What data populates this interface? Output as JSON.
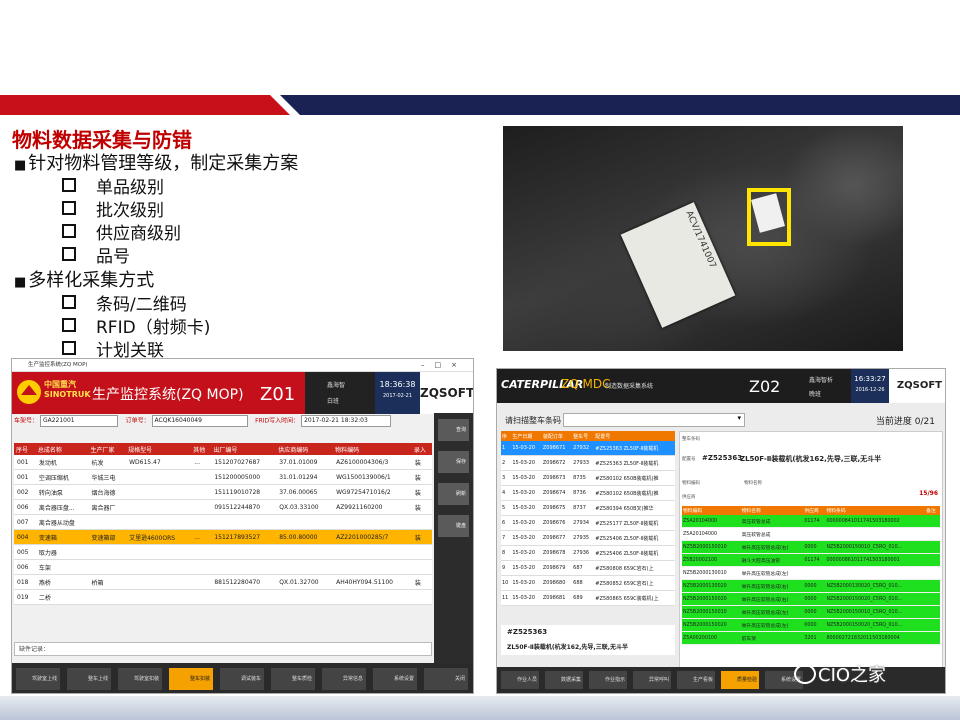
{
  "slide": {
    "title": "物料数据采集与防错",
    "sections": [
      {
        "heading": "针对物料管理等级，制定采集方案",
        "items": [
          "单品级别",
          "批次级别",
          "供应商级别",
          "品号"
        ]
      },
      {
        "heading": "多样化采集方式",
        "items": [
          "条码/二维码",
          "RFID（射频卡)",
          "计划关联"
        ]
      }
    ]
  },
  "photo": {
    "paper_text": "ACV/1741007"
  },
  "left_app": {
    "window_title": "生产监控系统(ZQ MOP)",
    "brand_cn": "中国重汽",
    "brand_en": "SINOTRUK",
    "system_title": "生产监控系统(ZQ MOP)",
    "station": "Z01",
    "user_name": "鑫海智",
    "shift": "白班",
    "time": "18:36:38",
    "date": "2017-02-21",
    "vendor_logo": "ZQSOFT",
    "filter": {
      "vin_label": "车架号：",
      "vin_value": "GA221001",
      "order_label": "订单号：",
      "order_value": "ACQK16040049",
      "frid_label": "FRID写入时间：",
      "frid_value": "2017-02-21 18:32:03"
    },
    "columns": [
      "序号",
      "总成名称",
      "生产厂家",
      "规格型号",
      "其他",
      "出厂编号",
      "供应商编码",
      "物料编码",
      "录入"
    ],
    "rows": [
      [
        "001",
        "发动机",
        "杭发",
        "WD615.47",
        "...",
        "151207027687",
        "37.01.01009",
        "AZ6100004306/3",
        "装"
      ],
      [
        "001",
        "空调压缩机",
        "华城三电",
        "",
        "",
        "151200005000",
        "31.01.01294",
        "WG1500139006/1",
        "装"
      ],
      [
        "002",
        "转向油泵",
        "烟台海德",
        "",
        "",
        "151119010728",
        "37.06.00065",
        "WG9725471016/2",
        "装"
      ],
      [
        "006",
        "离合器压盘...",
        "离合器厂",
        "",
        "",
        "091512244870",
        "QX.03.33100",
        "AZ9921160200",
        "装"
      ],
      [
        "007",
        "离合器从动盘",
        "",
        "",
        "",
        "",
        "",
        "",
        ""
      ],
      [
        "004",
        "变速箱",
        "变速箱部",
        "艾里逊4600ORS",
        "...",
        "151217893527",
        "85.00.80000",
        "AZ2201000285/7",
        "装"
      ],
      [
        "005",
        "取力器",
        "",
        "",
        "",
        "",
        "",
        "",
        ""
      ],
      [
        "006",
        "车架",
        "",
        "",
        "",
        "",
        "",
        "",
        ""
      ],
      [
        "018",
        "燕桥",
        "桥箱",
        "",
        "",
        "881512280470",
        "QX.01.32700",
        "AH40HY094.51100",
        "装"
      ],
      [
        "019",
        "二桥",
        "",
        "",
        "",
        "",
        "",
        "",
        ""
      ]
    ],
    "selected_row": 5,
    "side_buttons": [
      "查询",
      "保存",
      "刷新",
      "键盘"
    ],
    "log_label": "缺件记录：",
    "footer_buttons": [
      "驾驶室上线",
      "整车上线",
      "驾驶室扣装",
      "整车扣装",
      "调试装车",
      "整车质检",
      "异常信息",
      "系统设置",
      "关闭"
    ],
    "footer_active": 3
  },
  "right_app": {
    "brand": "CATERPILLAR",
    "system_name": "ZQ MDC",
    "system_sub": "制造数据采集系统",
    "station": "Z02",
    "user_name": "鑫海智析",
    "shift": "晚班",
    "time": "16:33:27",
    "date": "2016-12-26",
    "vendor_logo": "ZQSOFT",
    "scan_label": "请扫描整车条码",
    "progress": "当前进度 0/21",
    "left_columns": [
      "序",
      "生产日期",
      "装配订单",
      "整车号",
      "配置号"
    ],
    "left_rows": [
      [
        "1",
        "15-03-20",
        "Z098671",
        "27932",
        "#Z525363 ZL50F-Ⅱ装载机"
      ],
      [
        "2",
        "15-03-20",
        "Z098672",
        "27933",
        "#Z525363 ZL50F-Ⅱ装载机"
      ],
      [
        "3",
        "15-03-20",
        "Z098673",
        "8735",
        "#Z580102 650B装载机(推"
      ],
      [
        "4",
        "15-03-20",
        "Z098674",
        "8736",
        "#Z580102 650B装载机(推"
      ],
      [
        "5",
        "15-03-20",
        "Z098675",
        "8737",
        "#Z580394 650B叉(推华"
      ],
      [
        "6",
        "15-03-20",
        "Z098676",
        "27934",
        "#Z525177 ZL50F-Ⅱ装载机"
      ],
      [
        "7",
        "15-03-20",
        "Z098677",
        "27935",
        "#Z525406 ZL50F-Ⅱ装载机"
      ],
      [
        "8",
        "15-03-20",
        "Z098678",
        "27936",
        "#Z525406 ZL50F-Ⅱ装载机"
      ],
      [
        "9",
        "15-03-20",
        "Z098679",
        "687",
        "#Z580808 659C岩石(上"
      ],
      [
        "10",
        "15-03-20",
        "Z098680",
        "688",
        "#Z580852 659C岩石(上"
      ],
      [
        "11",
        "15-03-20",
        "Z098681",
        "689",
        "#Z580865 659C装载机(上"
      ]
    ],
    "selected_left_row": 0,
    "left_box_code": "#Z525363",
    "left_box_name": "ZL50F-Ⅱ装载机(杭发162,先导,三联,无斗半",
    "panel": {
      "vin_label": "整车条码",
      "config_label": "配置号",
      "config_code": "#Z525363",
      "config_name": "ZL50F-Ⅱ装载机(杭发162,先导,三联,无斗半",
      "part_code_label": "物料编码",
      "part_name_label": "物料名称",
      "supplier_label": "供应商",
      "count": "15/96",
      "columns": [
        "物料编码",
        "物料名称",
        "供应商",
        "物料条码",
        "备注"
      ],
      "rows": [
        {
          "ok": true,
          "cells": [
            "Z5A20104000",
            "高压软管总成",
            "01174",
            "000000841011741503180002",
            ""
          ]
        },
        {
          "ok": false,
          "cells": [
            "Z5A20104000",
            "高压软管总成",
            "",
            "",
            ""
          ]
        },
        {
          "ok": true,
          "cells": [
            "NZ5B2000150010",
            "举升高压软管总成(右)",
            "0000",
            "NZ5B2000150010_C5RQ_010...",
            ""
          ]
        },
        {
          "ok": true,
          "cells": [
            "Z5B20002100",
            "融斗大腔高压油管",
            "01174",
            "000000861011741503180001",
            ""
          ]
        },
        {
          "ok": false,
          "cells": [
            "NZ5B2000130010",
            "举升高压软管总成(左)",
            "",
            "",
            ""
          ]
        },
        {
          "ok": true,
          "cells": [
            "NZ5B2000130020",
            "举升高压软管总成(右)",
            "0000",
            "NZ5B2000130020_C5RQ_010...",
            ""
          ]
        },
        {
          "ok": true,
          "cells": [
            "NZ5B2000150020",
            "举升高压软管总成(右)",
            "0000",
            "NZ5B2000150020_C5RQ_010...",
            ""
          ]
        },
        {
          "ok": true,
          "cells": [
            "NZ5B2000150010",
            "举升高压软管总成(左)",
            "0000",
            "NZ5B2000150010_C5RQ_010...",
            ""
          ]
        },
        {
          "ok": true,
          "cells": [
            "NZ5B2000150020",
            "举升高压软管总成(左)",
            "0000",
            "NZ5B2000150020_C5RQ_010...",
            ""
          ]
        },
        {
          "ok": true,
          "cells": [
            "Z5A00200100",
            "前车架",
            "3201",
            "800002721832011503180004",
            ""
          ]
        }
      ]
    },
    "footer_buttons": [
      "作业人员",
      "数据采集",
      "作业指示",
      "异常呼叫",
      "生产看板",
      "质量检验",
      "系统设置"
    ],
    "footer_active": 5
  },
  "watermark": "CIO之家",
  "colors": {
    "brand_red": "#c4101a",
    "navy": "#1a2254",
    "accent_orange": "#f07800",
    "ok_green": "#1ee01e",
    "selected_yellow": "#ffb400"
  }
}
